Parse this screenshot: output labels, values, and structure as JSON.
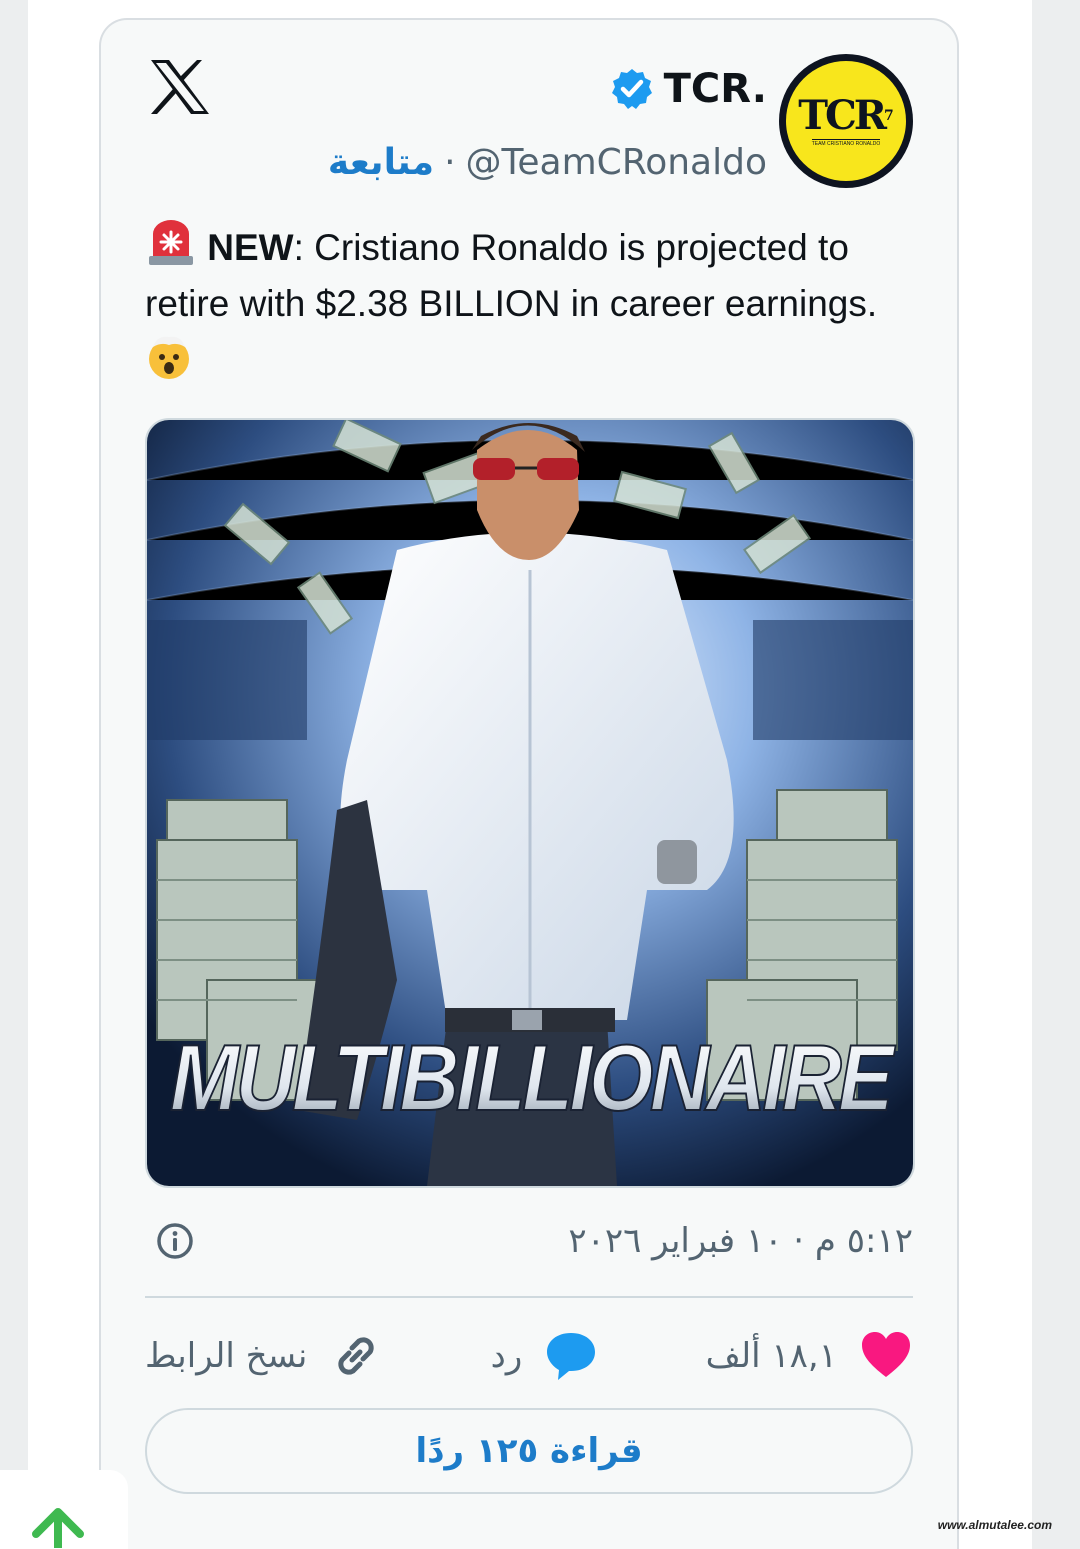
{
  "author": {
    "display_name": "TCR.",
    "handle": "@TeamCRonaldo",
    "separator": "·",
    "follow_label": "متابعة",
    "avatar_text": "TCR",
    "avatar_subtext": "TEAM CRISTIANO RONALDO",
    "verified_color": "#1d9bf0"
  },
  "tweet": {
    "label": "NEW",
    "text_before": ": Cristiano Ronaldo is projected to retire with $2.38 BILLION in career earnings. ",
    "image_caption": "MULTIBILLIONAIRE"
  },
  "meta": {
    "timestamp": "٥:١٢ م · ١٠ فبراير ٢٠٢٦"
  },
  "actions": {
    "likes": "١٨,١ ألف",
    "reply": "رد",
    "copy_link": "نسخ الرابط"
  },
  "read_replies": "قراءة ١٢٥ ردًا",
  "watermark": "www.almutalee.com",
  "colors": {
    "like": "#f91880",
    "reply": "#1d9bf0",
    "link": "#1d7cc9",
    "scroll_arrow": "#3fb950"
  }
}
